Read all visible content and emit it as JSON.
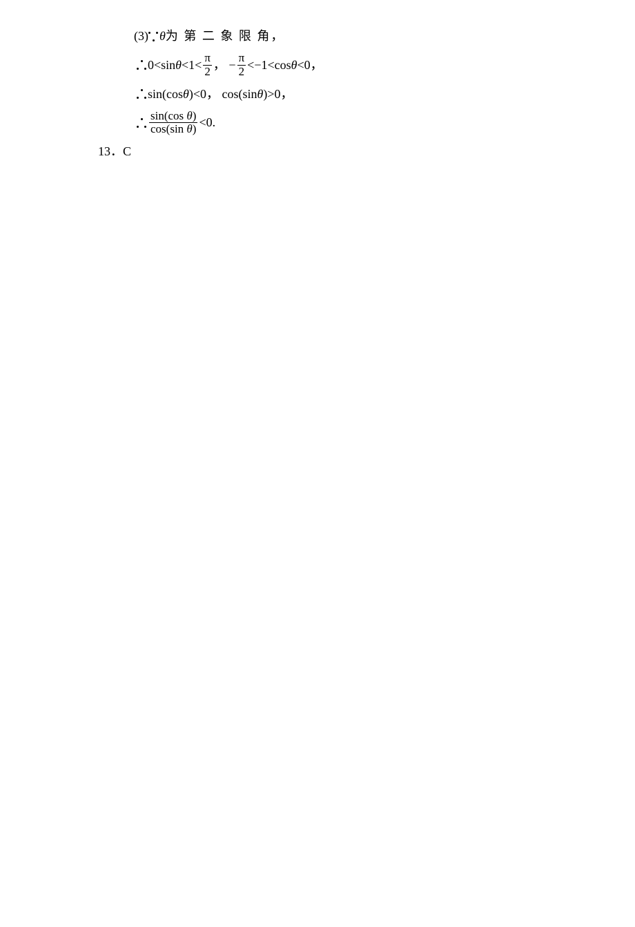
{
  "line1": {
    "prefix": "(3)",
    "theta": "θ",
    "text": " 为 第 二 象 限 角，"
  },
  "line2": {
    "p1": "0<sin ",
    "theta1": "θ",
    "p2": "<1<",
    "frac1_num": "π",
    "frac1_den": "2",
    "p3": "，  −",
    "frac2_num": "π",
    "frac2_den": "2",
    "p4": "<−1<cos ",
    "theta2": "θ",
    "p5": "<0，"
  },
  "line3": {
    "p1": "sin(cos ",
    "theta1": "θ",
    "p2": ")<0， cos(sin ",
    "theta2": "θ",
    "p3": ")>0，"
  },
  "line4": {
    "frac_num_p1": "sin(cos ",
    "frac_num_theta": "θ",
    "frac_num_p2": ")",
    "frac_den_p1": "cos(sin ",
    "frac_den_theta": "θ",
    "frac_den_p2": ")",
    "suffix": "<0."
  },
  "answer": {
    "num": "13．",
    "letter": "C"
  }
}
